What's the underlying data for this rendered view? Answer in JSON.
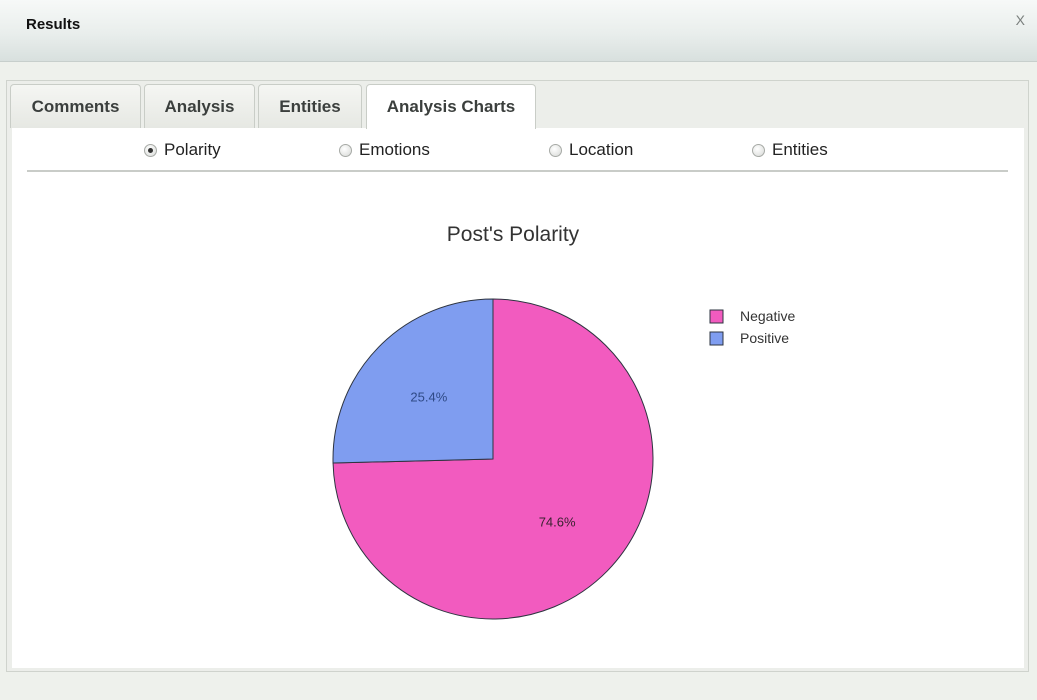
{
  "window": {
    "title": "Results",
    "close_label": "X"
  },
  "tabs": [
    {
      "label": "Comments",
      "active": false
    },
    {
      "label": "Analysis",
      "active": false
    },
    {
      "label": "Entities",
      "active": false
    },
    {
      "label": "Analysis Charts",
      "active": true
    }
  ],
  "radios": [
    {
      "label": "Polarity",
      "checked": true
    },
    {
      "label": "Emotions",
      "checked": false
    },
    {
      "label": "Location",
      "checked": false
    },
    {
      "label": "Entities",
      "checked": false
    }
  ],
  "chart_data": {
    "type": "pie",
    "title": "Post's Polarity",
    "legend_position": "right",
    "slices": [
      {
        "label": "Negative",
        "value": 74.6,
        "text": "74.6%",
        "color": "#f25bbf"
      },
      {
        "label": "Positive",
        "value": 25.4,
        "text": "25.4%",
        "color": "#7f9df0"
      }
    ]
  }
}
